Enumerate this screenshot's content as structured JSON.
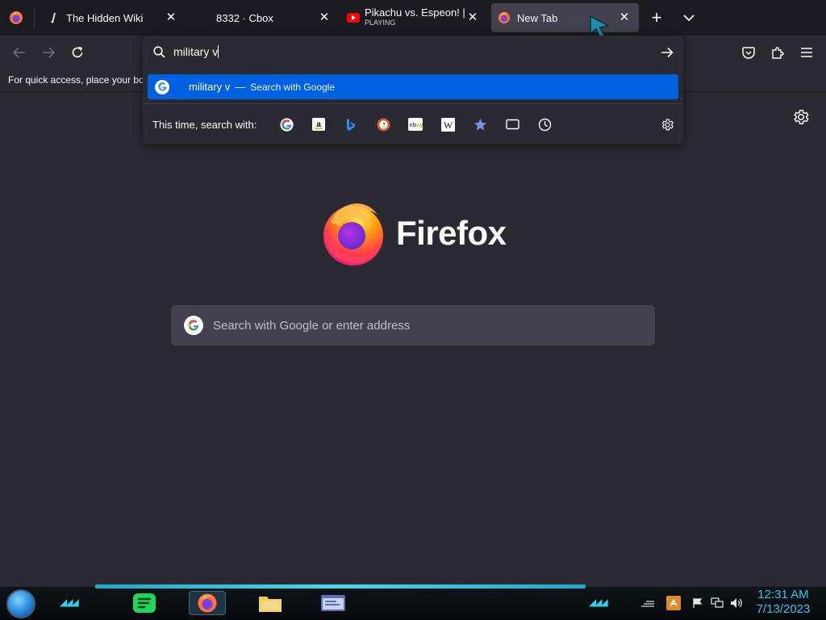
{
  "browser": {
    "tabs": [
      {
        "title": "The Hidden Wiki",
        "favicon": "hidden-wiki-icon",
        "subtitle": ""
      },
      {
        "title": "8332 · Cbox",
        "favicon": "",
        "subtitle": ""
      },
      {
        "title": "Pikachu vs. Espeon! | Pok",
        "favicon": "youtube-icon",
        "subtitle": "PLAYING"
      },
      {
        "title": "New Tab",
        "favicon": "firefox-icon",
        "subtitle": "",
        "active": true
      }
    ],
    "close_glyph": "✕",
    "new_tab_glyph": "+",
    "tab_list_glyph": "∨"
  },
  "urlbar": {
    "typed": "military v",
    "suggestion": {
      "text": "military v",
      "separator": "—",
      "action": "Search with Google"
    },
    "one_off_label": "This time, search with:",
    "one_off_engines": [
      "google-icon",
      "amazon-icon",
      "bing-icon",
      "duckduckgo-icon",
      "ebay-icon",
      "wikipedia-icon",
      "bookmarks-icon",
      "tabs-icon",
      "history-icon"
    ],
    "settings_icon": "gear-icon"
  },
  "bookmarks_bar": {
    "hint": "For quick access, place your boo"
  },
  "newtab": {
    "brand": "Firefox",
    "search_placeholder": "Search with Google or enter address",
    "settings_icon": "gear-icon"
  },
  "taskbar": {
    "apps": [
      "spotify-icon",
      "firefox-icon",
      "file-explorer-icon",
      "app-window-icon"
    ],
    "tray_icons": [
      "flag-icon",
      "network-icon",
      "volume-icon"
    ],
    "time": "12:31 AM",
    "date": "7/13/2023"
  },
  "colors": {
    "accent_blue": "#0061e0",
    "clock_cyan": "#2bc7e8",
    "active_tab": "#42414d",
    "bg": "#2b2a33"
  }
}
